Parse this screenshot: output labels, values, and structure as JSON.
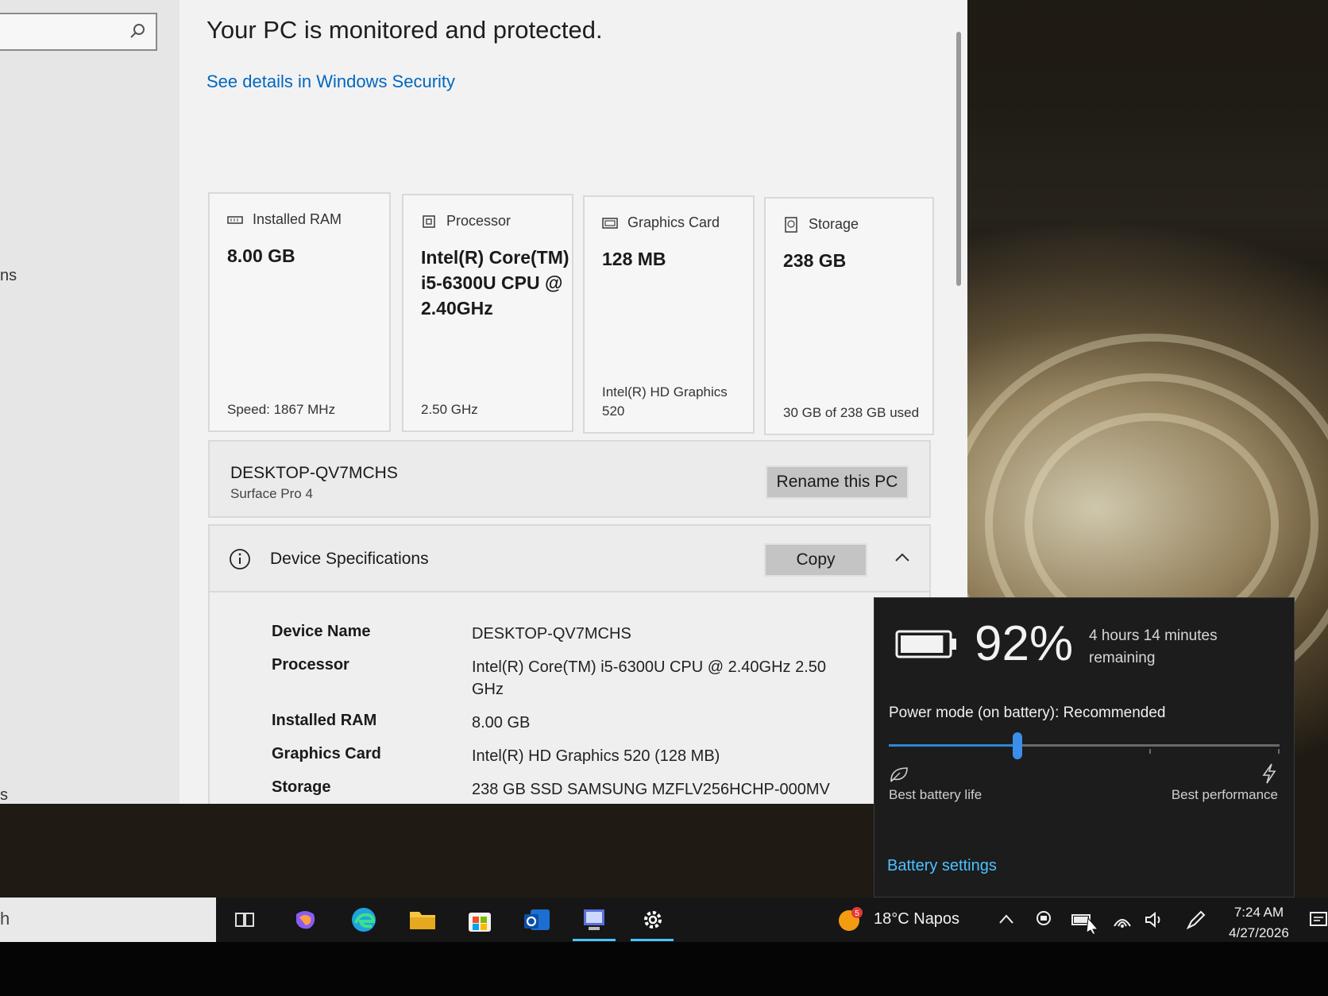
{
  "security": {
    "status": "Your PC is monitored and protected.",
    "link": "See details in Windows Security"
  },
  "sidebar": {
    "fragment_1": "ns",
    "fragment_2": "s"
  },
  "cards": [
    {
      "title": "Installed RAM",
      "icon": "ram-icon",
      "value": "8.00 GB",
      "footer": "Speed: 1867 MHz"
    },
    {
      "title": "Processor",
      "icon": "processor-icon",
      "value": "Intel(R) Core(TM) i5-6300U CPU @ 2.40GHz",
      "footer": "2.50 GHz"
    },
    {
      "title": "Graphics Card",
      "icon": "graphics-card-icon",
      "value": "128 MB",
      "footer": "Intel(R) HD Graphics 520"
    },
    {
      "title": "Storage",
      "icon": "storage-icon",
      "value": "238 GB",
      "footer": "30 GB of 238 GB used"
    }
  ],
  "pc": {
    "name": "DESKTOP-QV7MCHS",
    "model": "Surface Pro 4",
    "rename_label": "Rename this PC"
  },
  "device_specs": {
    "title": "Device Specifications",
    "copy_label": "Copy",
    "rows": [
      {
        "key": "Device Name",
        "value": "DESKTOP-QV7MCHS"
      },
      {
        "key": "Processor",
        "value": "Intel(R) Core(TM) i5-6300U CPU @ 2.40GHz   2.50 GHz"
      },
      {
        "key": "Installed RAM",
        "value": "8.00 GB"
      },
      {
        "key": "Graphics Card",
        "value": "Intel(R) HD Graphics 520 (128 MB)"
      },
      {
        "key": "Storage",
        "value": "238 GB SSD SAMSUNG MZFLV256HCHP-000MV"
      }
    ]
  },
  "battery": {
    "percent": "92%",
    "percent_value": 92,
    "remaining": "4 hours 14 minutes remaining",
    "power_mode": "Power mode (on battery): Recommended",
    "slider_position": 0.33,
    "left_label": "Best battery life",
    "right_label": "Best performance",
    "settings_link": "Battery settings"
  },
  "taskbar": {
    "search_fragment": "h",
    "apps": [
      "task-view-icon",
      "copilot-icon",
      "edge-icon",
      "file-explorer-icon",
      "store-icon",
      "outlook-icon",
      "system-info-icon",
      "settings-icon"
    ],
    "weather_badge": "5",
    "weather": "18°C  Napos",
    "time": "7:24 AM",
    "date": "4/27/2026"
  },
  "colors": {
    "accent": "#0067c0",
    "flyout_link": "#4cc2ff",
    "slider": "#2b88d8"
  }
}
